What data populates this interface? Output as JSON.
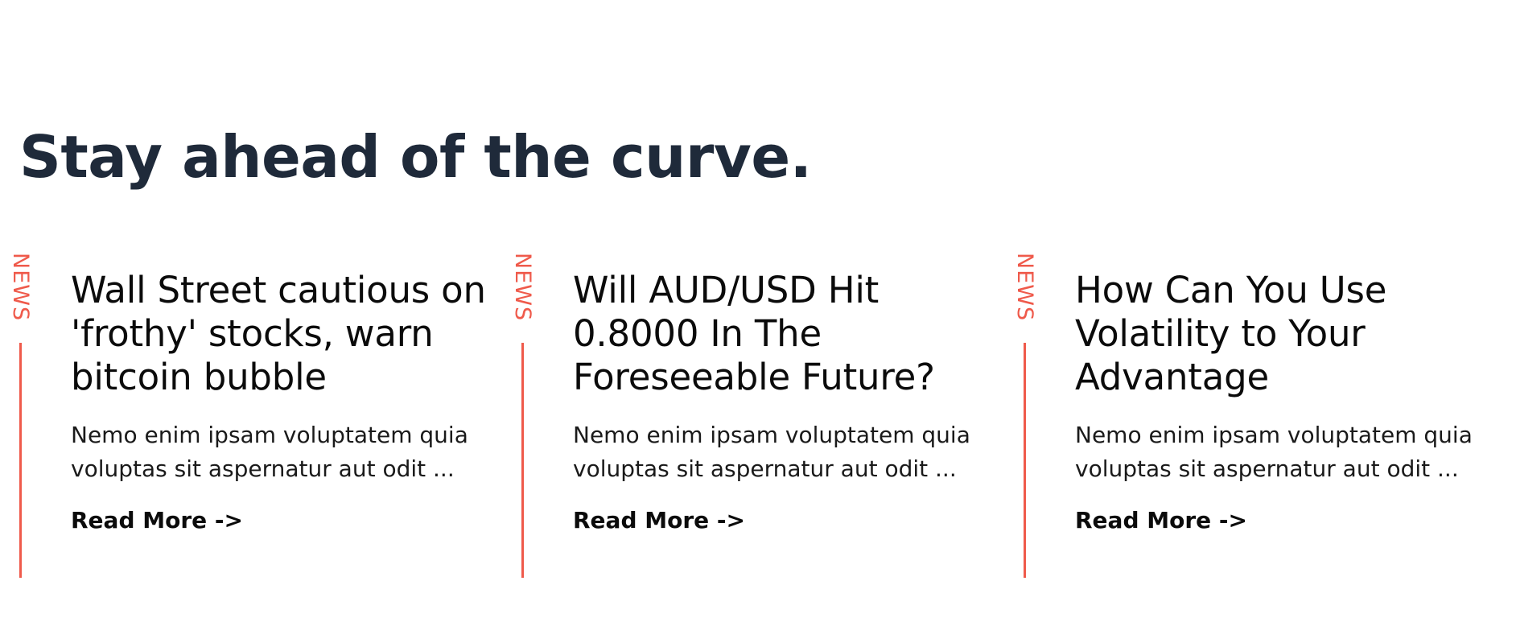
{
  "section": {
    "heading": "Stay ahead of the curve."
  },
  "cards": [
    {
      "category": "NEWS",
      "title": "Wall Street cautious on 'frothy' stocks, warn bitcoin bubble",
      "excerpt": "Nemo enim ipsam voluptatem quia voluptas sit aspernatur aut odit ...",
      "cta": "Read More ->"
    },
    {
      "category": "NEWS",
      "title": "Will AUD/USD Hit 0.8000 In The Foreseeable Future?",
      "excerpt": "Nemo enim ipsam voluptatem quia voluptas sit aspernatur aut odit ...",
      "cta": "Read More ->"
    },
    {
      "category": "NEWS",
      "title": "How Can You Use Volatility to Your Advantage",
      "excerpt": "Nemo enim ipsam voluptatem quia voluptas sit aspernatur aut odit ...",
      "cta": "Read More ->"
    }
  ],
  "colors": {
    "accent": "#ef5a4b",
    "heading": "#1f2a3a",
    "text": "#111111"
  }
}
